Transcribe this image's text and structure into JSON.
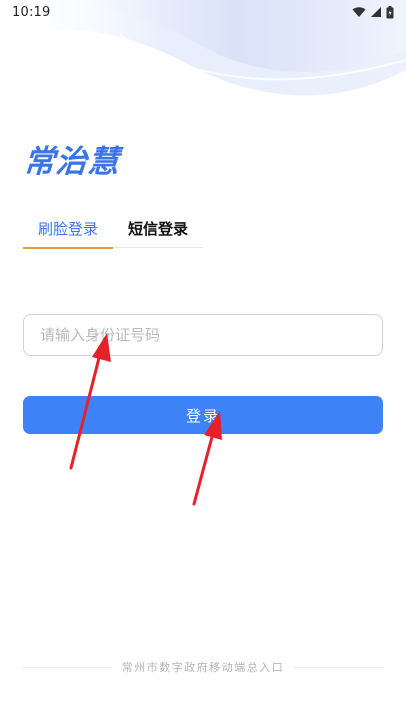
{
  "status_bar": {
    "time": "10:19",
    "icons": [
      "wifi-icon",
      "signal-icon",
      "battery-icon"
    ]
  },
  "app": {
    "logo_text": "常治慧"
  },
  "tabs": [
    {
      "label": "刷脸登录",
      "active": true
    },
    {
      "label": "短信登录",
      "active": false
    }
  ],
  "form": {
    "id_input": {
      "value": "",
      "placeholder": "请输入身份证号码"
    },
    "login_label": "登录"
  },
  "footer": {
    "text": "常州市数字政府移动端总入口"
  },
  "colors": {
    "brand": "#3a74e8",
    "button": "#3d82f6",
    "tab_underline": "#e2a13b",
    "arrow": "#e8202a"
  }
}
